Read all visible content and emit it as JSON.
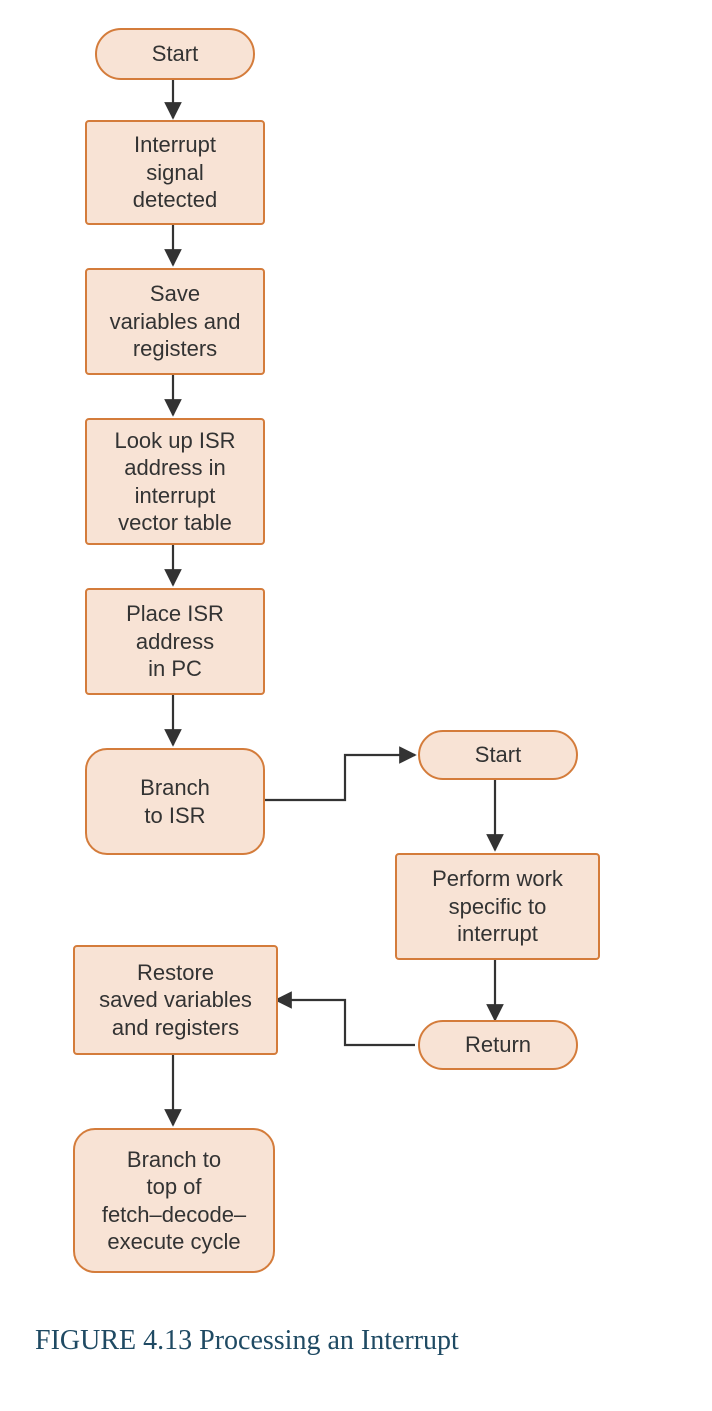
{
  "chart_data": {
    "type": "flowchart",
    "nodes": [
      {
        "id": "start1",
        "shape": "terminator",
        "text": "Start"
      },
      {
        "id": "n1",
        "shape": "process",
        "text": "Interrupt signal detected"
      },
      {
        "id": "n2",
        "shape": "process",
        "text": "Save variables and registers"
      },
      {
        "id": "n3",
        "shape": "process",
        "text": "Look up ISR address in interrupt vector table"
      },
      {
        "id": "n4",
        "shape": "process",
        "text": "Place ISR address in PC"
      },
      {
        "id": "n5",
        "shape": "rounded",
        "text": "Branch to ISR"
      },
      {
        "id": "start2",
        "shape": "terminator",
        "text": "Start"
      },
      {
        "id": "n6",
        "shape": "process",
        "text": "Perform work specific to interrupt"
      },
      {
        "id": "return",
        "shape": "terminator",
        "text": "Return"
      },
      {
        "id": "n7",
        "shape": "process",
        "text": "Restore saved variables and registers"
      },
      {
        "id": "n8",
        "shape": "rounded",
        "text": "Branch to top of fetch–decode–execute cycle"
      }
    ],
    "edges": [
      {
        "from": "start1",
        "to": "n1"
      },
      {
        "from": "n1",
        "to": "n2"
      },
      {
        "from": "n2",
        "to": "n3"
      },
      {
        "from": "n3",
        "to": "n4"
      },
      {
        "from": "n4",
        "to": "n5"
      },
      {
        "from": "n5",
        "to": "start2"
      },
      {
        "from": "start2",
        "to": "n6"
      },
      {
        "from": "n6",
        "to": "return"
      },
      {
        "from": "return",
        "to": "n7"
      },
      {
        "from": "n7",
        "to": "n8"
      }
    ]
  },
  "nodes": {
    "start1": "Start",
    "n1": "Interrupt\nsignal\ndetected",
    "n2": "Save\nvariables and\nregisters",
    "n3": "Look up ISR\naddress in\ninterrupt\nvector table",
    "n4": "Place ISR\naddress\nin PC",
    "n5": "Branch\nto ISR",
    "start2": "Start",
    "n6": "Perform work\nspecific to\ninterrupt",
    "return": "Return",
    "n7": "Restore\nsaved variables\nand registers",
    "n8": "Branch to\ntop of\nfetch–decode–\nexecute cycle"
  },
  "caption": "FIGURE 4.13 Processing an Interrupt"
}
